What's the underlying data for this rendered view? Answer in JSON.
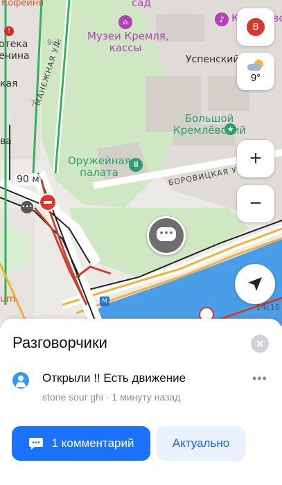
{
  "map": {
    "labels": {
      "cafe": "Кофейня",
      "sad": "сад",
      "museum_line1": "Музеи Кремля,",
      "museum_line2": "кассы",
      "library_line1": "отека",
      "library_line2": "енина",
      "kremlin_building": "Кремлёвский",
      "uspensky": "Успенский",
      "manezhnaya": "МАНЕЖНАЯ УЛ.",
      "kaya": "кая",
      "building_9c1": "9с1",
      "building_7": "7",
      "palace_line1": "Большой",
      "palace_line2": "Кремлёвский",
      "armory_line1": "Оружейная",
      "armory_line2": "палата",
      "borovitskaya": "БОРОВИЦКАЯ УЛ.",
      "va": "ва",
      "distance": "90 м",
      "um": "um",
      "building_14c10": "14с10",
      "metro_badge": "М"
    },
    "notification_count": "8",
    "weather": {
      "temp": "9°",
      "icon": "partly-cloudy-icon"
    },
    "zoom_in": "+",
    "zoom_out": "−"
  },
  "sheet": {
    "title": "Разговорчики",
    "message": "Открыли !! Есть движение",
    "author": "stone sour ghi",
    "time": "1 минуту назад",
    "separator": " · ",
    "more": "•••",
    "comments_button": "1 комментарий",
    "relevant_button": "Актуально"
  },
  "colors": {
    "primary": "#1b72ff",
    "water": "#4a9ee8",
    "park": "#cfe8c3",
    "traffic_red": "#c8412c",
    "traffic_orange": "#f2b133"
  }
}
